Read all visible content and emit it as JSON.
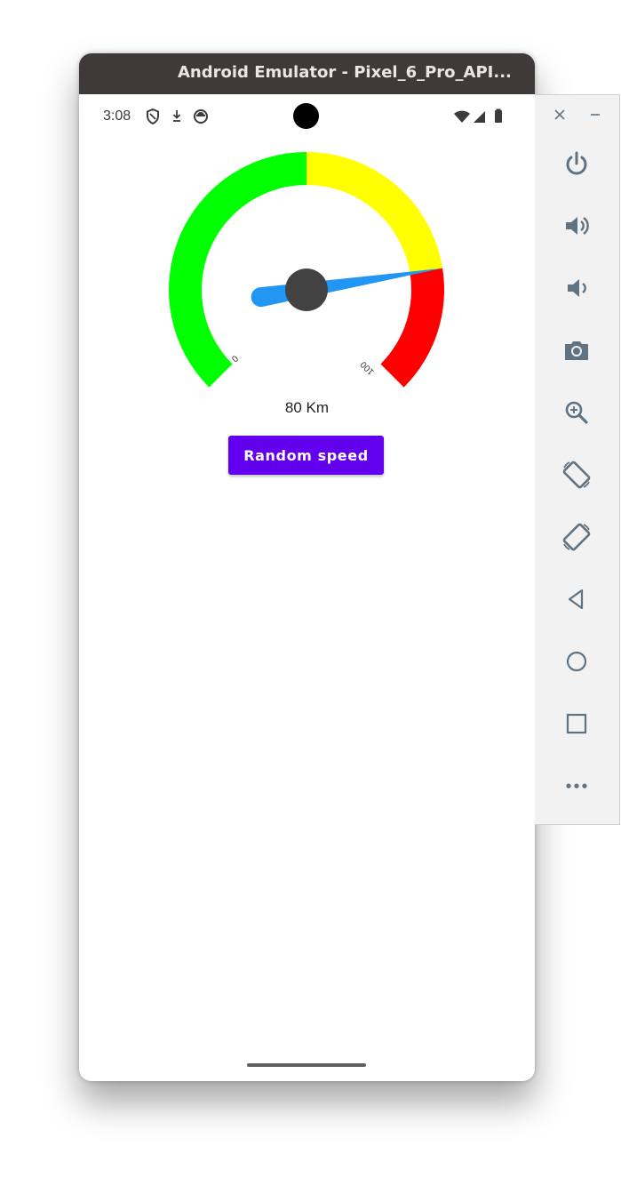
{
  "window": {
    "title": "Android Emulator - Pixel_6_Pro_API..."
  },
  "status_bar": {
    "time": "3:08",
    "left_icons": [
      "shield-icon",
      "download-arrow-icon",
      "sync-circle-icon"
    ],
    "right_icons": [
      "wifi-icon",
      "cellular-signal-icon",
      "battery-icon"
    ]
  },
  "speedometer": {
    "min_label": "0",
    "max_label": "100",
    "value": 80,
    "zones": [
      {
        "name": "green",
        "color": "#00ff00"
      },
      {
        "name": "yellow",
        "color": "#ffff00"
      },
      {
        "name": "red",
        "color": "#ff0000"
      }
    ],
    "needle_color": "#2196f3",
    "hub_color": "#424242"
  },
  "speed_text": "80 Km",
  "button": {
    "label": "Random speed",
    "color": "#6200ee"
  },
  "side_panel": {
    "window_controls": [
      "close-icon",
      "minimize-icon"
    ],
    "buttons": [
      "power-icon",
      "volume-up-icon",
      "volume-down-icon",
      "camera-icon",
      "zoom-icon",
      "rotate-left-icon",
      "rotate-right-icon",
      "back-icon",
      "home-icon",
      "overview-icon",
      "more-icon"
    ]
  }
}
